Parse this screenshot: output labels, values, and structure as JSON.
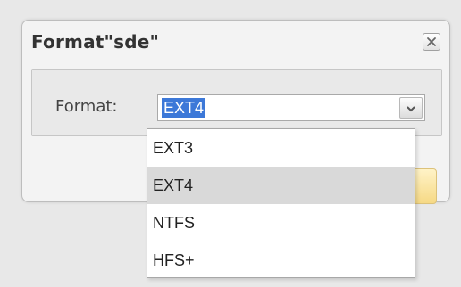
{
  "dialog": {
    "title": "Format\"sde\"",
    "close_icon": "close-icon"
  },
  "form": {
    "format_label": "Format:",
    "selected_value": "EXT4",
    "dropdown_icon": "chevron-down-icon",
    "options": [
      "EXT3",
      "EXT4",
      "NTFS",
      "HFS+"
    ],
    "highlighted_option": "EXT4"
  },
  "colors": {
    "selection_blue": "#3c78d8",
    "dialog_bg": "#f3f3f3",
    "panel_bg": "#e9e9e9",
    "option_highlight": "#d9d9d9",
    "button_yellow": "#f6d985"
  }
}
